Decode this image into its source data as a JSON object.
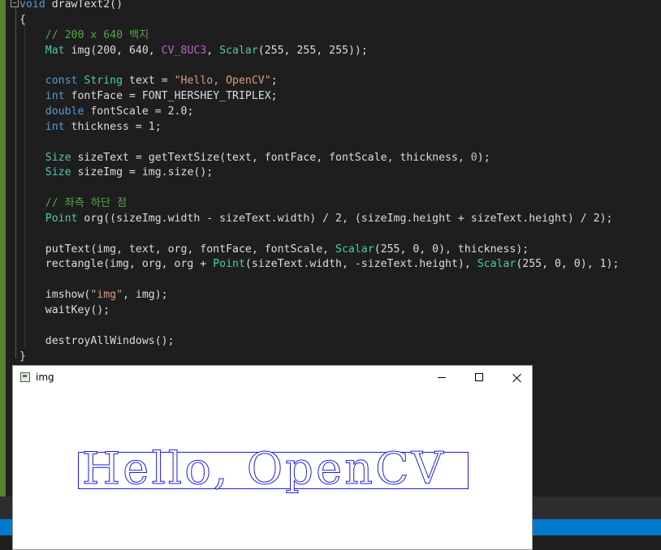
{
  "editor": {
    "lines": [
      [
        {
          "t": "void",
          "c": "kw"
        },
        {
          "t": " drawText2()",
          "c": ""
        }
      ],
      [
        {
          "t": "{",
          "c": ""
        }
      ],
      [
        {
          "t": "    // 200 x 640 백지",
          "c": "comment"
        }
      ],
      [
        {
          "t": "    ",
          "c": ""
        },
        {
          "t": "Mat",
          "c": "type"
        },
        {
          "t": " img(200, 640, ",
          "c": ""
        },
        {
          "t": "CV_8UC3",
          "c": "macro"
        },
        {
          "t": ", ",
          "c": ""
        },
        {
          "t": "Scalar",
          "c": "type"
        },
        {
          "t": "(255, 255, 255));",
          "c": ""
        }
      ],
      [
        {
          "t": "",
          "c": ""
        }
      ],
      [
        {
          "t": "    ",
          "c": ""
        },
        {
          "t": "const",
          "c": "kw"
        },
        {
          "t": " ",
          "c": ""
        },
        {
          "t": "String",
          "c": "type"
        },
        {
          "t": " text = ",
          "c": ""
        },
        {
          "t": "\"Hello, OpenCV\"",
          "c": "str"
        },
        {
          "t": ";",
          "c": ""
        }
      ],
      [
        {
          "t": "    ",
          "c": ""
        },
        {
          "t": "int",
          "c": "kw"
        },
        {
          "t": " fontFace = FONT_HERSHEY_TRIPLEX;",
          "c": ""
        }
      ],
      [
        {
          "t": "    ",
          "c": ""
        },
        {
          "t": "double",
          "c": "kw"
        },
        {
          "t": " fontScale = 2.0;",
          "c": ""
        }
      ],
      [
        {
          "t": "    ",
          "c": ""
        },
        {
          "t": "int",
          "c": "kw"
        },
        {
          "t": " thickness = 1;",
          "c": ""
        }
      ],
      [
        {
          "t": "",
          "c": ""
        }
      ],
      [
        {
          "t": "    ",
          "c": ""
        },
        {
          "t": "Size",
          "c": "type"
        },
        {
          "t": " sizeText = getTextSize(text, fontFace, fontScale, thickness, ",
          "c": ""
        },
        {
          "t": "0",
          "c": "num"
        },
        {
          "t": ");",
          "c": ""
        }
      ],
      [
        {
          "t": "    ",
          "c": ""
        },
        {
          "t": "Size",
          "c": "type"
        },
        {
          "t": " sizeImg = img.size();",
          "c": ""
        }
      ],
      [
        {
          "t": "",
          "c": ""
        }
      ],
      [
        {
          "t": "    // 좌측 하단 점",
          "c": "comment"
        }
      ],
      [
        {
          "t": "    ",
          "c": ""
        },
        {
          "t": "Point",
          "c": "type"
        },
        {
          "t": " org((sizeImg.width - sizeText.width) / 2, (sizeImg.height + sizeText.height) / 2);",
          "c": ""
        }
      ],
      [
        {
          "t": "",
          "c": ""
        }
      ],
      [
        {
          "t": "    putText(img, text, org, fontFace, fontScale, ",
          "c": ""
        },
        {
          "t": "Scalar",
          "c": "type"
        },
        {
          "t": "(255, 0, 0), thickness);",
          "c": ""
        }
      ],
      [
        {
          "t": "    rectangle(img, org, org + ",
          "c": ""
        },
        {
          "t": "Point",
          "c": "type"
        },
        {
          "t": "(sizeText.width, -sizeText.height), ",
          "c": ""
        },
        {
          "t": "Scalar",
          "c": "type"
        },
        {
          "t": "(255, 0, 0), 1);",
          "c": ""
        }
      ],
      [
        {
          "t": "",
          "c": ""
        }
      ],
      [
        {
          "t": "    imshow(",
          "c": ""
        },
        {
          "t": "\"img\"",
          "c": "str"
        },
        {
          "t": ", img);",
          "c": ""
        }
      ],
      [
        {
          "t": "    waitKey();",
          "c": ""
        }
      ],
      [
        {
          "t": "",
          "c": ""
        }
      ],
      [
        {
          "t": "    destroyAllWindows();",
          "c": ""
        }
      ],
      [
        {
          "t": "}",
          "c": ""
        }
      ]
    ]
  },
  "window": {
    "title": "img",
    "icons": {
      "app": "window-app-icon",
      "minimize": "minimize-icon",
      "maximize": "maximize-icon",
      "close": "close-icon"
    },
    "image_text": "Hello, OpenCV",
    "text_color": "#1c1cdc"
  }
}
